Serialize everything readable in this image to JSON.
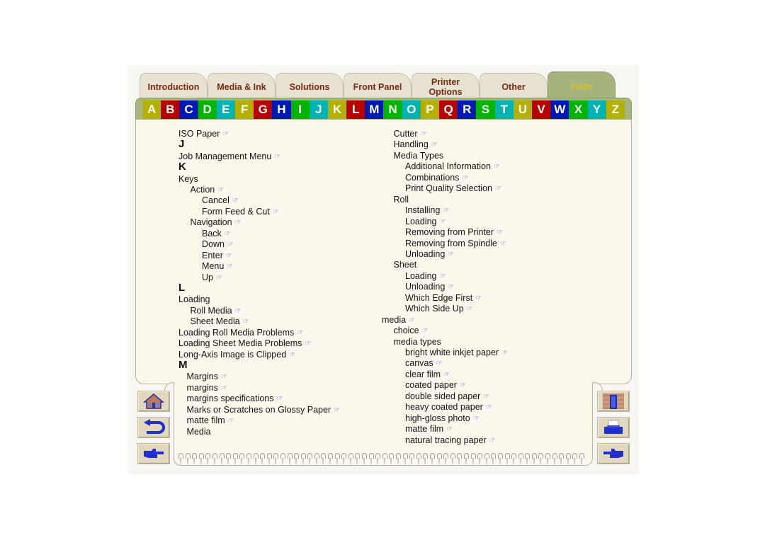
{
  "tabs": [
    {
      "label": "Introduction",
      "active": false
    },
    {
      "label": "Media & Ink",
      "active": false
    },
    {
      "label": "Solutions",
      "active": false
    },
    {
      "label": "Front Panel",
      "active": false
    },
    {
      "label": "Printer Options",
      "active": false
    },
    {
      "label": "Other",
      "active": false
    },
    {
      "label": "Index",
      "active": true
    }
  ],
  "letters": [
    {
      "label": "A",
      "color": "#b4b000"
    },
    {
      "label": "B",
      "color": "#b80000"
    },
    {
      "label": "C",
      "color": "#0018b4"
    },
    {
      "label": "D",
      "color": "#00b400"
    },
    {
      "label": "E",
      "color": "#00b4b4"
    },
    {
      "label": "F",
      "color": "#b4b000"
    },
    {
      "label": "G",
      "color": "#b80000"
    },
    {
      "label": "H",
      "color": "#0018b4"
    },
    {
      "label": "I",
      "color": "#00b400"
    },
    {
      "label": "J",
      "color": "#00b4b4"
    },
    {
      "label": "K",
      "color": "#b4b000"
    },
    {
      "label": "L",
      "color": "#b80000"
    },
    {
      "label": "M",
      "color": "#0018b4"
    },
    {
      "label": "N",
      "color": "#00b400"
    },
    {
      "label": "O",
      "color": "#00b4b4"
    },
    {
      "label": "P",
      "color": "#b4b000"
    },
    {
      "label": "Q",
      "color": "#b80000"
    },
    {
      "label": "R",
      "color": "#0018b4"
    },
    {
      "label": "S",
      "color": "#00b400"
    },
    {
      "label": "T",
      "color": "#00b4b4"
    },
    {
      "label": "U",
      "color": "#b4b000"
    },
    {
      "label": "V",
      "color": "#b80000"
    },
    {
      "label": "W",
      "color": "#0018b4"
    },
    {
      "label": "X",
      "color": "#00b400"
    },
    {
      "label": "Y",
      "color": "#00b4b4"
    },
    {
      "label": "Z",
      "color": "#b4b000"
    }
  ],
  "pointer_glyph": "☞",
  "left_column": [
    {
      "text": "ISO Paper",
      "level": 0,
      "link": true
    },
    {
      "text": "J",
      "heading": true
    },
    {
      "text": "Job Management Menu",
      "level": 0,
      "link": true
    },
    {
      "text": "K",
      "heading": true
    },
    {
      "text": "Keys",
      "level": 0,
      "link": false
    },
    {
      "text": "Action",
      "level": 1,
      "link": true
    },
    {
      "text": "Cancel",
      "level": 2,
      "link": true
    },
    {
      "text": "Form Feed & Cut",
      "level": 2,
      "link": true
    },
    {
      "text": "Navigation",
      "level": 1,
      "link": true
    },
    {
      "text": "Back",
      "level": 2,
      "link": true
    },
    {
      "text": "Down",
      "level": 2,
      "link": true
    },
    {
      "text": "Enter",
      "level": 2,
      "link": true
    },
    {
      "text": "Menu",
      "level": 2,
      "link": true
    },
    {
      "text": "Up",
      "level": 2,
      "link": true
    },
    {
      "text": "L",
      "heading": true
    },
    {
      "text": "Loading",
      "level": 0,
      "link": false
    },
    {
      "text": "Roll Media",
      "level": 1,
      "link": true
    },
    {
      "text": "Sheet Media",
      "level": 1,
      "link": true
    },
    {
      "text": "Loading Roll Media Problems",
      "level": 0,
      "link": true
    },
    {
      "text": "Loading Sheet Media Problems",
      "level": 0,
      "link": true
    },
    {
      "text": "Long-Axis Image is Clipped",
      "level": 0,
      "link": true
    },
    {
      "text": "M",
      "heading": true
    },
    {
      "text": "Margins",
      "level": 0.7,
      "link": true
    },
    {
      "text": "margins",
      "level": 0.7,
      "link": true
    },
    {
      "text": "margins specifications",
      "level": 0.7,
      "link": true
    },
    {
      "text": "Marks or Scratches on Glossy Paper",
      "level": 0.7,
      "link": true
    },
    {
      "text": "matte film",
      "level": 0.7,
      "link": true
    },
    {
      "text": "Media",
      "level": 0.7,
      "link": false
    }
  ],
  "right_column": [
    {
      "text": "Cutter",
      "level": 1,
      "link": true
    },
    {
      "text": "Handling",
      "level": 1,
      "link": true
    },
    {
      "text": "Media Types",
      "level": 1,
      "link": false
    },
    {
      "text": "Additional Information",
      "level": 2,
      "link": true
    },
    {
      "text": "Combinations",
      "level": 2,
      "link": true
    },
    {
      "text": "Print Quality Selection",
      "level": 2,
      "link": true
    },
    {
      "text": "Roll",
      "level": 1,
      "link": false
    },
    {
      "text": "Installing",
      "level": 2,
      "link": true
    },
    {
      "text": "Loading",
      "level": 2,
      "link": true
    },
    {
      "text": "Removing from Printer",
      "level": 2,
      "link": true
    },
    {
      "text": "Removing from Spindle",
      "level": 2,
      "link": true
    },
    {
      "text": "Unloading",
      "level": 2,
      "link": true
    },
    {
      "text": "Sheet",
      "level": 1,
      "link": false
    },
    {
      "text": "Loading",
      "level": 2,
      "link": true
    },
    {
      "text": "Unloading",
      "level": 2,
      "link": true
    },
    {
      "text": "Which Edge First",
      "level": 2,
      "link": true
    },
    {
      "text": "Which Side Up",
      "level": 2,
      "link": true
    },
    {
      "text": "media",
      "level": 0,
      "link": true
    },
    {
      "text": "choice",
      "level": 1,
      "link": true
    },
    {
      "text": "media types",
      "level": 1,
      "link": false
    },
    {
      "text": "bright white inkjet paper",
      "level": 2,
      "link": true
    },
    {
      "text": "canvas",
      "level": 2,
      "link": true
    },
    {
      "text": "clear film",
      "level": 2,
      "link": true
    },
    {
      "text": "coated paper",
      "level": 2,
      "link": true
    },
    {
      "text": "double sided paper",
      "level": 2,
      "link": true
    },
    {
      "text": "heavy coated paper",
      "level": 2,
      "link": true
    },
    {
      "text": "high-gloss photo",
      "level": 2,
      "link": true
    },
    {
      "text": "matte film",
      "level": 2,
      "link": true
    },
    {
      "text": "natural tracing paper",
      "level": 2,
      "link": true
    }
  ],
  "nav_left": [
    {
      "name": "home-button",
      "icon": "home-icon"
    },
    {
      "name": "back-button",
      "icon": "return-arrow-icon"
    },
    {
      "name": "next-page-button",
      "icon": "pointing-hand-right-icon"
    }
  ],
  "nav_right": [
    {
      "name": "exit-button",
      "icon": "door-icon"
    },
    {
      "name": "print-button",
      "icon": "printer-icon"
    },
    {
      "name": "previous-page-button",
      "icon": "pointing-hand-left-icon"
    }
  ]
}
